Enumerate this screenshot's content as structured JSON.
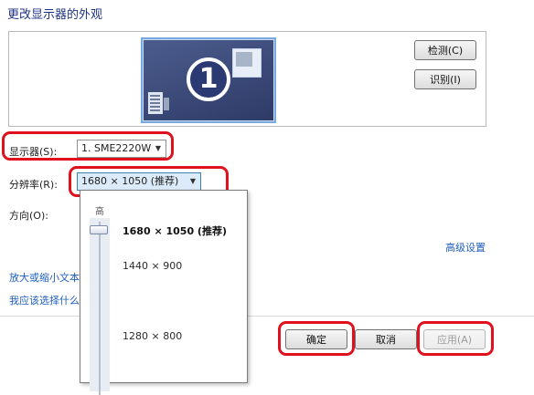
{
  "title": "更改显示器的外观",
  "preview": {
    "monitor_number": "1"
  },
  "buttons": {
    "detect": "检测(C)",
    "identify": "识别(I)",
    "ok": "确定",
    "cancel": "取消",
    "apply": "应用(A)"
  },
  "fields": {
    "display_label": "显示器(S):",
    "display_value": "1. SME2220W",
    "resolution_label": "分辨率(R):",
    "resolution_value": "1680 × 1050 (推荐)",
    "orientation_label": "方向(O):"
  },
  "links": {
    "advanced": "高级设置",
    "text_size": "放大或缩小文本",
    "which_settings": "我应该选择什么"
  },
  "resolution_dropdown": {
    "high_label": "高",
    "options": [
      "1680 × 1050 (推荐)",
      "1440 × 900",
      "1280 × 800"
    ],
    "selected_index": 0
  },
  "colors": {
    "highlight_ring": "#e0101c",
    "title_blue": "#1e3287",
    "link_blue": "#1f5ebf"
  },
  "icons": [
    "monitor-icon",
    "chevron-down-icon",
    "slider-thumb"
  ]
}
